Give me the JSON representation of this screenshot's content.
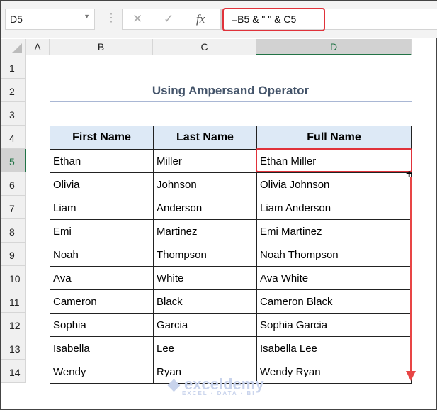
{
  "name_box": "D5",
  "formula": "=B5 & \" \" & C5",
  "columns": [
    "A",
    "B",
    "C",
    "D"
  ],
  "rows": [
    "1",
    "2",
    "3",
    "4",
    "5",
    "6",
    "7",
    "8",
    "9",
    "10",
    "11",
    "12",
    "13",
    "14"
  ],
  "title": "Using Ampersand Operator",
  "headers": [
    "First Name",
    "Last Name",
    "Full Name"
  ],
  "data": [
    [
      "Ethan",
      "Miller",
      "Ethan Miller"
    ],
    [
      "Olivia",
      "Johnson",
      "Olivia Johnson"
    ],
    [
      "Liam",
      "Anderson",
      "Liam Anderson"
    ],
    [
      "Emi",
      "Martinez",
      "Emi Martinez"
    ],
    [
      "Noah",
      "Thompson",
      "Noah Thompson"
    ],
    [
      "Ava",
      "White",
      "Ava White"
    ],
    [
      "Cameron",
      "Black",
      "Cameron Black"
    ],
    [
      "Sophia",
      "Garcia",
      "Sophia Garcia"
    ],
    [
      "Isabella",
      "Lee",
      "Isabella Lee"
    ],
    [
      "Wendy",
      "Ryan",
      "Wendy Ryan"
    ]
  ],
  "watermark": {
    "name": "exceldemy",
    "tag": "EXCEL · DATA · BI"
  },
  "accent": "#e0323a"
}
